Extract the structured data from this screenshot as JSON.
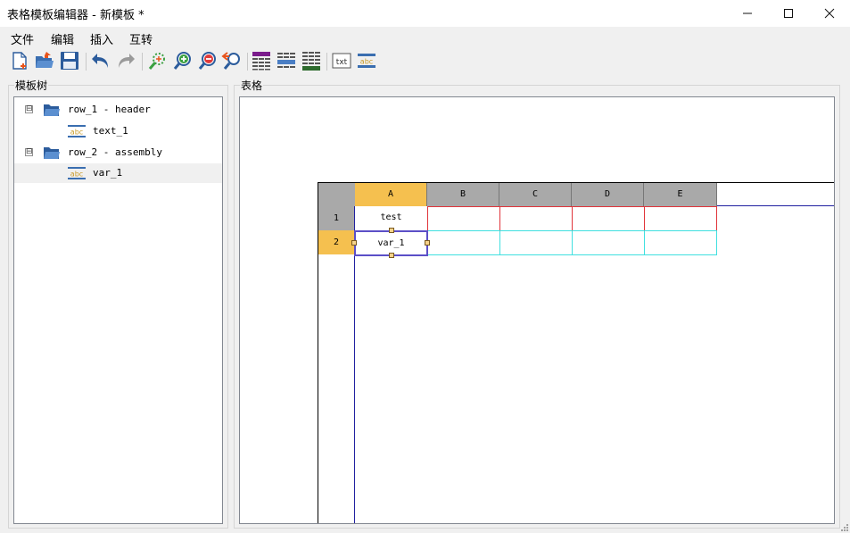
{
  "window": {
    "title": "表格模板编辑器 - 新模板 *"
  },
  "menu": [
    "文件",
    "编辑",
    "插入",
    "互转"
  ],
  "toolbar": {
    "buttons": [
      {
        "name": "new-file-icon"
      },
      {
        "name": "open-folder-icon"
      },
      {
        "name": "save-icon"
      },
      {
        "name": "undo-icon"
      },
      {
        "name": "redo-icon"
      },
      {
        "name": "zoom-fit-icon"
      },
      {
        "name": "zoom-in-icon"
      },
      {
        "name": "zoom-out-icon"
      },
      {
        "name": "zoom-reset-icon"
      },
      {
        "name": "insert-table-header-icon"
      },
      {
        "name": "insert-table-row-icon"
      },
      {
        "name": "insert-table-footer-icon"
      },
      {
        "name": "insert-text-icon"
      },
      {
        "name": "insert-variable-icon"
      }
    ],
    "txt_label": "txt",
    "abc_label": "abc"
  },
  "tree": {
    "title": "模板树",
    "items": [
      {
        "label": "row_1 - header",
        "level": 0,
        "icon": "folder-icon",
        "toggle": "⊟"
      },
      {
        "label": "text_1",
        "level": 1,
        "icon": "abc-text-icon"
      },
      {
        "label": "row_2 - assembly",
        "level": 0,
        "icon": "folder-icon",
        "toggle": "⊟"
      },
      {
        "label": "var_1",
        "level": 1,
        "icon": "abc-variable-icon",
        "selected": true
      }
    ],
    "icon_text": "abc"
  },
  "table": {
    "title": "表格",
    "columns": [
      "A",
      "B",
      "C",
      "D",
      "E"
    ],
    "rows": [
      "1",
      "2"
    ],
    "cells": [
      [
        "test",
        "",
        "",
        "",
        ""
      ],
      [
        "var_1",
        "",
        "",
        "",
        ""
      ]
    ],
    "selected_column": "A",
    "selected_row": "2",
    "selected_cell": "A2"
  },
  "colors": {
    "accent": "#f5c04f",
    "header_gray": "#a9a9a9",
    "row1_border": "#e0343a",
    "row2_border": "#40e0e0",
    "selection": "#5b4fc7"
  }
}
